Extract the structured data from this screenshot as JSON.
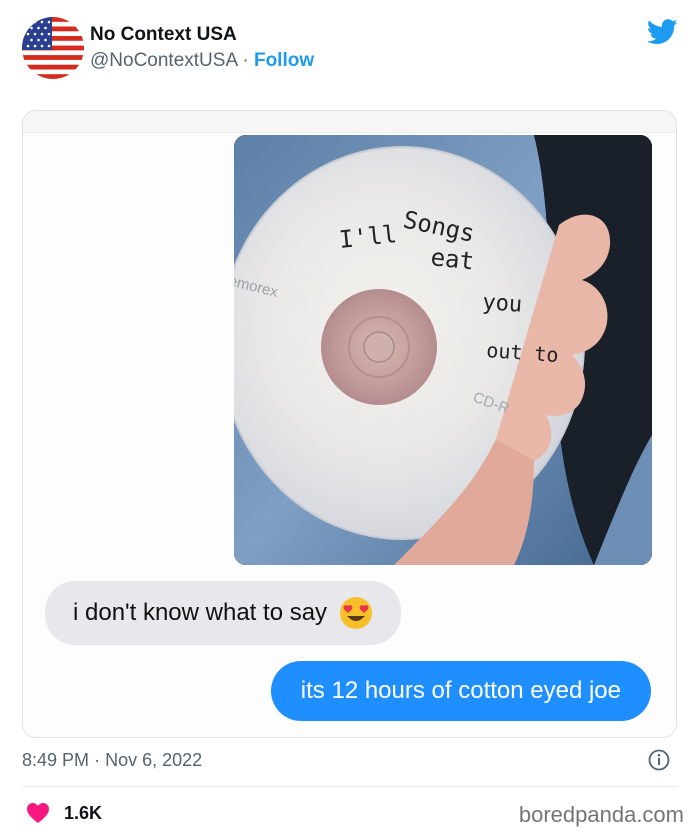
{
  "tweet": {
    "author": {
      "display_name": "No Context USA",
      "handle": "@NoContextUSA",
      "separator": "·",
      "follow_label": "Follow",
      "avatar_icon": "us-flag-icon"
    },
    "platform_icon": "twitter-bird-icon",
    "timestamp": {
      "time": "8:49 PM",
      "separator": "·",
      "date": "Nov 6, 2022"
    },
    "likes": {
      "count": "1.6K",
      "icon": "heart-icon"
    },
    "info_icon": "info-icon"
  },
  "screenshot": {
    "cd_handwriting": [
      "Songs",
      "I'll",
      "eat",
      "you",
      "out to"
    ],
    "cd_brand": "emorex",
    "cd_type": "CD-R",
    "incoming_message": "i don't know what to say",
    "incoming_emoji": "heart-eyes-emoji",
    "outgoing_message": "its 12 hours of cotton eyed joe"
  },
  "watermark": "boredpanda.com",
  "colors": {
    "accent": "#1d9bf0",
    "outgoing_bubble": "#1f8fff",
    "incoming_bubble": "#e7e8ec",
    "heart": "#f91880"
  }
}
